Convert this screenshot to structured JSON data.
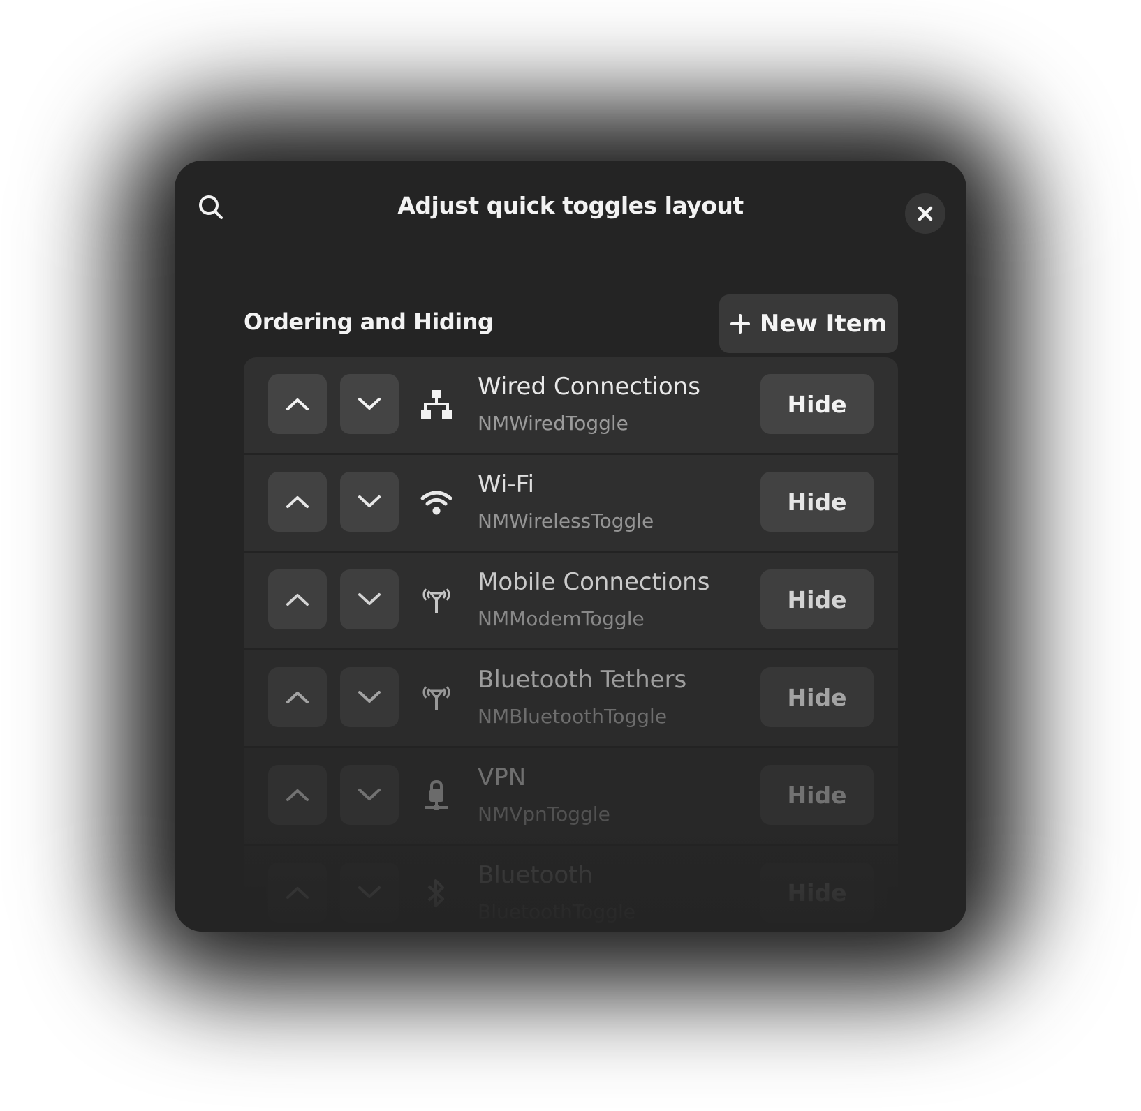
{
  "window": {
    "title": "Adjust quick toggles layout",
    "search_icon": "search-icon",
    "close_icon": "close-icon"
  },
  "section": {
    "title": "Ordering and Hiding",
    "new_item_button": {
      "icon": "plus-icon",
      "label": "New Item"
    }
  },
  "items": [
    {
      "title": "Wired Connections",
      "subtitle": "NMWiredToggle",
      "icon": "wired-network-icon",
      "hide_label": "Hide"
    },
    {
      "title": "Wi-Fi",
      "subtitle": "NMWirelessToggle",
      "icon": "wifi-icon",
      "hide_label": "Hide"
    },
    {
      "title": "Mobile Connections",
      "subtitle": "NMModemToggle",
      "icon": "antenna-icon",
      "hide_label": "Hide"
    },
    {
      "title": "Bluetooth Tethers",
      "subtitle": "NMBluetoothToggle",
      "icon": "antenna-icon",
      "hide_label": "Hide"
    },
    {
      "title": "VPN",
      "subtitle": "NMVpnToggle",
      "icon": "vpn-lock-icon",
      "hide_label": "Hide"
    },
    {
      "title": "Bluetooth",
      "subtitle": "BluetoothToggle",
      "icon": "bluetooth-icon",
      "hide_label": "Hide"
    }
  ],
  "colors": {
    "window_bg": "#242424",
    "row_bg": "#303030",
    "button_bg": "#444444",
    "text": "#f2f2f2",
    "subtext": "#9a9a9a"
  }
}
